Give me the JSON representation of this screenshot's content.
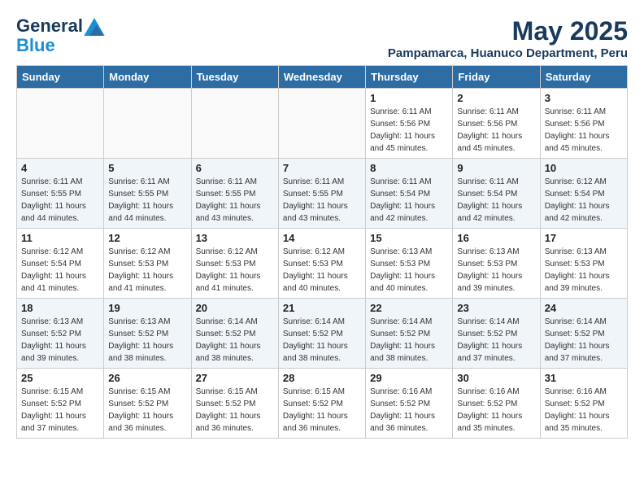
{
  "logo": {
    "line1": "General",
    "line2": "Blue"
  },
  "title": "May 2025",
  "subtitle": "Pampamarca, Huanuco Department, Peru",
  "days_of_week": [
    "Sunday",
    "Monday",
    "Tuesday",
    "Wednesday",
    "Thursday",
    "Friday",
    "Saturday"
  ],
  "weeks": [
    [
      {
        "day": "",
        "info": ""
      },
      {
        "day": "",
        "info": ""
      },
      {
        "day": "",
        "info": ""
      },
      {
        "day": "",
        "info": ""
      },
      {
        "day": "1",
        "info": "Sunrise: 6:11 AM\nSunset: 5:56 PM\nDaylight: 11 hours\nand 45 minutes."
      },
      {
        "day": "2",
        "info": "Sunrise: 6:11 AM\nSunset: 5:56 PM\nDaylight: 11 hours\nand 45 minutes."
      },
      {
        "day": "3",
        "info": "Sunrise: 6:11 AM\nSunset: 5:56 PM\nDaylight: 11 hours\nand 45 minutes."
      }
    ],
    [
      {
        "day": "4",
        "info": "Sunrise: 6:11 AM\nSunset: 5:55 PM\nDaylight: 11 hours\nand 44 minutes."
      },
      {
        "day": "5",
        "info": "Sunrise: 6:11 AM\nSunset: 5:55 PM\nDaylight: 11 hours\nand 44 minutes."
      },
      {
        "day": "6",
        "info": "Sunrise: 6:11 AM\nSunset: 5:55 PM\nDaylight: 11 hours\nand 43 minutes."
      },
      {
        "day": "7",
        "info": "Sunrise: 6:11 AM\nSunset: 5:55 PM\nDaylight: 11 hours\nand 43 minutes."
      },
      {
        "day": "8",
        "info": "Sunrise: 6:11 AM\nSunset: 5:54 PM\nDaylight: 11 hours\nand 42 minutes."
      },
      {
        "day": "9",
        "info": "Sunrise: 6:11 AM\nSunset: 5:54 PM\nDaylight: 11 hours\nand 42 minutes."
      },
      {
        "day": "10",
        "info": "Sunrise: 6:12 AM\nSunset: 5:54 PM\nDaylight: 11 hours\nand 42 minutes."
      }
    ],
    [
      {
        "day": "11",
        "info": "Sunrise: 6:12 AM\nSunset: 5:54 PM\nDaylight: 11 hours\nand 41 minutes."
      },
      {
        "day": "12",
        "info": "Sunrise: 6:12 AM\nSunset: 5:53 PM\nDaylight: 11 hours\nand 41 minutes."
      },
      {
        "day": "13",
        "info": "Sunrise: 6:12 AM\nSunset: 5:53 PM\nDaylight: 11 hours\nand 41 minutes."
      },
      {
        "day": "14",
        "info": "Sunrise: 6:12 AM\nSunset: 5:53 PM\nDaylight: 11 hours\nand 40 minutes."
      },
      {
        "day": "15",
        "info": "Sunrise: 6:13 AM\nSunset: 5:53 PM\nDaylight: 11 hours\nand 40 minutes."
      },
      {
        "day": "16",
        "info": "Sunrise: 6:13 AM\nSunset: 5:53 PM\nDaylight: 11 hours\nand 39 minutes."
      },
      {
        "day": "17",
        "info": "Sunrise: 6:13 AM\nSunset: 5:53 PM\nDaylight: 11 hours\nand 39 minutes."
      }
    ],
    [
      {
        "day": "18",
        "info": "Sunrise: 6:13 AM\nSunset: 5:52 PM\nDaylight: 11 hours\nand 39 minutes."
      },
      {
        "day": "19",
        "info": "Sunrise: 6:13 AM\nSunset: 5:52 PM\nDaylight: 11 hours\nand 38 minutes."
      },
      {
        "day": "20",
        "info": "Sunrise: 6:14 AM\nSunset: 5:52 PM\nDaylight: 11 hours\nand 38 minutes."
      },
      {
        "day": "21",
        "info": "Sunrise: 6:14 AM\nSunset: 5:52 PM\nDaylight: 11 hours\nand 38 minutes."
      },
      {
        "day": "22",
        "info": "Sunrise: 6:14 AM\nSunset: 5:52 PM\nDaylight: 11 hours\nand 38 minutes."
      },
      {
        "day": "23",
        "info": "Sunrise: 6:14 AM\nSunset: 5:52 PM\nDaylight: 11 hours\nand 37 minutes."
      },
      {
        "day": "24",
        "info": "Sunrise: 6:14 AM\nSunset: 5:52 PM\nDaylight: 11 hours\nand 37 minutes."
      }
    ],
    [
      {
        "day": "25",
        "info": "Sunrise: 6:15 AM\nSunset: 5:52 PM\nDaylight: 11 hours\nand 37 minutes."
      },
      {
        "day": "26",
        "info": "Sunrise: 6:15 AM\nSunset: 5:52 PM\nDaylight: 11 hours\nand 36 minutes."
      },
      {
        "day": "27",
        "info": "Sunrise: 6:15 AM\nSunset: 5:52 PM\nDaylight: 11 hours\nand 36 minutes."
      },
      {
        "day": "28",
        "info": "Sunrise: 6:15 AM\nSunset: 5:52 PM\nDaylight: 11 hours\nand 36 minutes."
      },
      {
        "day": "29",
        "info": "Sunrise: 6:16 AM\nSunset: 5:52 PM\nDaylight: 11 hours\nand 36 minutes."
      },
      {
        "day": "30",
        "info": "Sunrise: 6:16 AM\nSunset: 5:52 PM\nDaylight: 11 hours\nand 35 minutes."
      },
      {
        "day": "31",
        "info": "Sunrise: 6:16 AM\nSunset: 5:52 PM\nDaylight: 11 hours\nand 35 minutes."
      }
    ]
  ]
}
